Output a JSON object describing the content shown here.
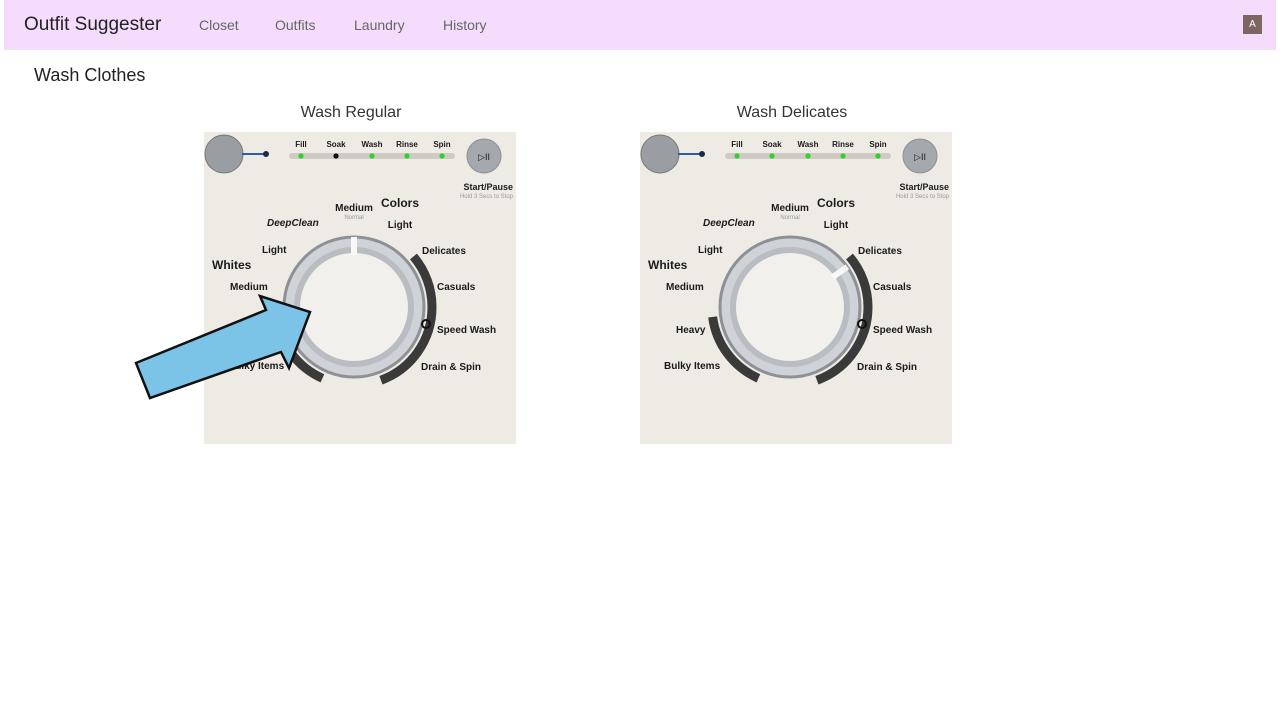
{
  "navbar": {
    "brand": "Outfit Suggester",
    "links": [
      "Closet",
      "Outfits",
      "Laundry",
      "History"
    ],
    "avatar_initial": "A"
  },
  "page": {
    "title": "Wash Clothes"
  },
  "panels": [
    {
      "title": "Wash Regular",
      "selected_cycle": "Medium"
    },
    {
      "title": "Wash Delicates",
      "selected_cycle": "Delicates"
    }
  ],
  "washer": {
    "stages": [
      "Fill",
      "Soak",
      "Wash",
      "Rinse",
      "Spin"
    ],
    "start_label": "Start/Pause",
    "start_sub": "Hold 3 Secs to Stop",
    "labels": {
      "medium_top": "Medium",
      "normal": "Normal",
      "colors": "Colors",
      "light_right": "Light",
      "deepclean": "DeepClean",
      "light_left": "Light",
      "whites": "Whites",
      "medium_left": "Medium",
      "heavy": "Heavy",
      "bulky": "Bulky Items",
      "delicates": "Delicates",
      "casuals": "Casuals",
      "speed_wash": "Speed Wash",
      "drain_spin": "Drain & Spin"
    }
  },
  "colors": {
    "navbar_bg": "#f5dcfc",
    "arrow_fill": "#7cc3e8",
    "stage_led": "#2fd12f"
  },
  "arrow": {
    "points_to": "Medium"
  }
}
